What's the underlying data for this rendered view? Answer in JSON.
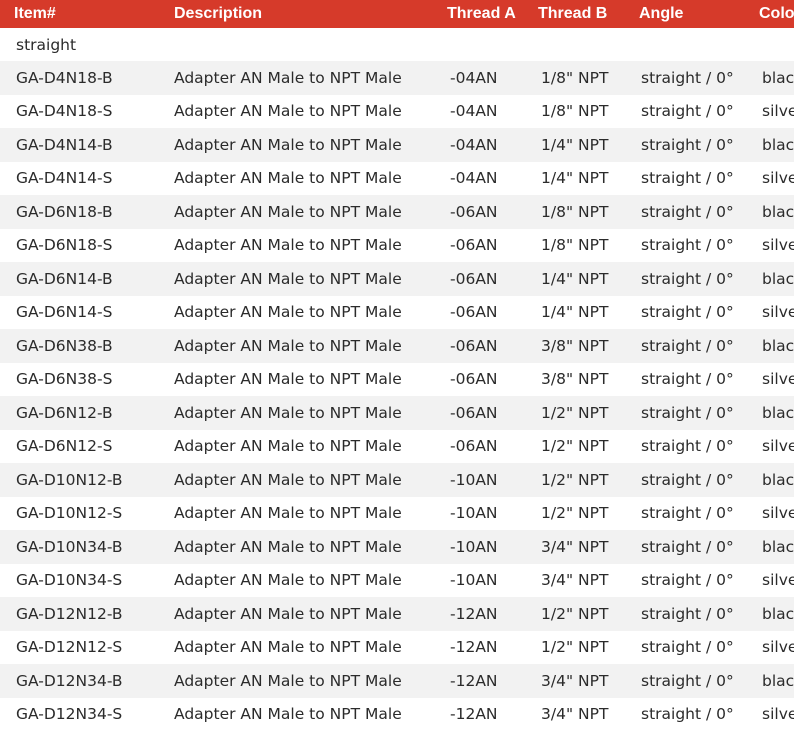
{
  "headers": {
    "item": "Item#",
    "description": "Description",
    "thread_a": "Thread A",
    "thread_b": "Thread B",
    "angle": "Angle",
    "color": "Color"
  },
  "group_label": "straight",
  "colors": {
    "header_bg": "#d63a2a",
    "stripe_bg": "#f2f2f2"
  },
  "rows": [
    {
      "item": "GA-D4N18-B",
      "description": "Adapter AN Male to NPT Male",
      "thread_a": "-04AN",
      "thread_b": "1/8\" NPT",
      "angle": "straight / 0°",
      "color": "black"
    },
    {
      "item": "GA-D4N18-S",
      "description": "Adapter AN Male to NPT Male",
      "thread_a": "-04AN",
      "thread_b": "1/8\" NPT",
      "angle": "straight / 0°",
      "color": "silver"
    },
    {
      "item": "GA-D4N14-B",
      "description": "Adapter AN Male to NPT Male",
      "thread_a": "-04AN",
      "thread_b": "1/4\" NPT",
      "angle": "straight / 0°",
      "color": "black"
    },
    {
      "item": "GA-D4N14-S",
      "description": "Adapter AN Male to NPT Male",
      "thread_a": "-04AN",
      "thread_b": "1/4\" NPT",
      "angle": "straight / 0°",
      "color": "silver"
    },
    {
      "item": "GA-D6N18-B",
      "description": "Adapter AN Male to NPT Male",
      "thread_a": "-06AN",
      "thread_b": "1/8\" NPT",
      "angle": "straight / 0°",
      "color": "black"
    },
    {
      "item": "GA-D6N18-S",
      "description": "Adapter AN Male to NPT Male",
      "thread_a": "-06AN",
      "thread_b": "1/8\" NPT",
      "angle": "straight / 0°",
      "color": "silver"
    },
    {
      "item": "GA-D6N14-B",
      "description": "Adapter AN Male to NPT Male",
      "thread_a": "-06AN",
      "thread_b": "1/4\" NPT",
      "angle": "straight / 0°",
      "color": "black"
    },
    {
      "item": "GA-D6N14-S",
      "description": "Adapter AN Male to NPT Male",
      "thread_a": "-06AN",
      "thread_b": "1/4\" NPT",
      "angle": "straight / 0°",
      "color": "silver"
    },
    {
      "item": "GA-D6N38-B",
      "description": "Adapter AN Male to NPT Male",
      "thread_a": "-06AN",
      "thread_b": "3/8\" NPT",
      "angle": "straight / 0°",
      "color": "black"
    },
    {
      "item": "GA-D6N38-S",
      "description": "Adapter AN Male to NPT Male",
      "thread_a": "-06AN",
      "thread_b": "3/8\" NPT",
      "angle": "straight / 0°",
      "color": "silver"
    },
    {
      "item": "GA-D6N12-B",
      "description": "Adapter AN Male to NPT Male",
      "thread_a": "-06AN",
      "thread_b": "1/2\" NPT",
      "angle": "straight / 0°",
      "color": "black"
    },
    {
      "item": "GA-D6N12-S",
      "description": "Adapter AN Male to NPT Male",
      "thread_a": "-06AN",
      "thread_b": "1/2\" NPT",
      "angle": "straight / 0°",
      "color": "silver"
    },
    {
      "item": "GA-D10N12-B",
      "description": "Adapter AN Male to NPT Male",
      "thread_a": "-10AN",
      "thread_b": "1/2\" NPT",
      "angle": "straight / 0°",
      "color": "black"
    },
    {
      "item": "GA-D10N12-S",
      "description": "Adapter AN Male to NPT Male",
      "thread_a": "-10AN",
      "thread_b": "1/2\" NPT",
      "angle": "straight / 0°",
      "color": "silver"
    },
    {
      "item": "GA-D10N34-B",
      "description": "Adapter AN Male to NPT Male",
      "thread_a": "-10AN",
      "thread_b": "3/4\" NPT",
      "angle": "straight / 0°",
      "color": "black"
    },
    {
      "item": "GA-D10N34-S",
      "description": "Adapter AN Male to NPT Male",
      "thread_a": "-10AN",
      "thread_b": "3/4\" NPT",
      "angle": "straight / 0°",
      "color": "silver"
    },
    {
      "item": "GA-D12N12-B",
      "description": "Adapter AN Male to NPT Male",
      "thread_a": "-12AN",
      "thread_b": "1/2\" NPT",
      "angle": "straight / 0°",
      "color": "black"
    },
    {
      "item": "GA-D12N12-S",
      "description": "Adapter AN Male to NPT Male",
      "thread_a": "-12AN",
      "thread_b": "1/2\" NPT",
      "angle": "straight / 0°",
      "color": "silver"
    },
    {
      "item": "GA-D12N34-B",
      "description": "Adapter AN Male to NPT Male",
      "thread_a": "-12AN",
      "thread_b": "3/4\" NPT",
      "angle": "straight / 0°",
      "color": "black"
    },
    {
      "item": "GA-D12N34-S",
      "description": "Adapter AN Male to NPT Male",
      "thread_a": "-12AN",
      "thread_b": "3/4\" NPT",
      "angle": "straight / 0°",
      "color": "silver"
    }
  ]
}
